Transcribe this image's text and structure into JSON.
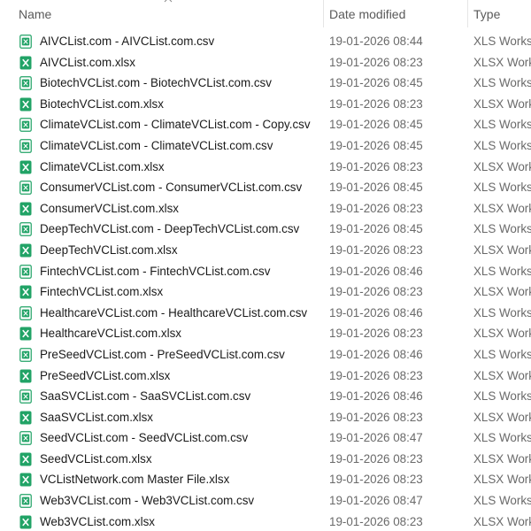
{
  "header": {
    "name_label": "Name",
    "date_label": "Date modified",
    "type_label": "Type",
    "sort_icon": "chevron-up-icon"
  },
  "files": [
    {
      "name": "AIVCList.com - AIVCList.com.csv",
      "date": "19-01-2026 08:44",
      "type": "XLS Works",
      "icon": "csv"
    },
    {
      "name": "AIVCList.com.xlsx",
      "date": "19-01-2026 08:23",
      "type": "XLSX Work",
      "icon": "xlsx"
    },
    {
      "name": "BiotechVCList.com - BiotechVCList.com.csv",
      "date": "19-01-2026 08:45",
      "type": "XLS Works",
      "icon": "csv"
    },
    {
      "name": "BiotechVCList.com.xlsx",
      "date": "19-01-2026 08:23",
      "type": "XLSX Work",
      "icon": "xlsx"
    },
    {
      "name": "ClimateVCList.com - ClimateVCList.com - Copy.csv",
      "date": "19-01-2026 08:45",
      "type": "XLS Works",
      "icon": "csv"
    },
    {
      "name": "ClimateVCList.com - ClimateVCList.com.csv",
      "date": "19-01-2026 08:45",
      "type": "XLS Works",
      "icon": "csv"
    },
    {
      "name": "ClimateVCList.com.xlsx",
      "date": "19-01-2026 08:23",
      "type": "XLSX Work",
      "icon": "xlsx"
    },
    {
      "name": "ConsumerVCList.com - ConsumerVCList.com.csv",
      "date": "19-01-2026 08:45",
      "type": "XLS Works",
      "icon": "csv"
    },
    {
      "name": "ConsumerVCList.com.xlsx",
      "date": "19-01-2026 08:23",
      "type": "XLSX Work",
      "icon": "xlsx"
    },
    {
      "name": "DeepTechVCList.com - DeepTechVCList.com.csv",
      "date": "19-01-2026 08:45",
      "type": "XLS Works",
      "icon": "csv"
    },
    {
      "name": "DeepTechVCList.com.xlsx",
      "date": "19-01-2026 08:23",
      "type": "XLSX Work",
      "icon": "xlsx"
    },
    {
      "name": "FintechVCList.com - FintechVCList.com.csv",
      "date": "19-01-2026 08:46",
      "type": "XLS Works",
      "icon": "csv"
    },
    {
      "name": "FintechVCList.com.xlsx",
      "date": "19-01-2026 08:23",
      "type": "XLSX Work",
      "icon": "xlsx"
    },
    {
      "name": "HealthcareVCList.com - HealthcareVCList.com.csv",
      "date": "19-01-2026 08:46",
      "type": "XLS Works",
      "icon": "csv"
    },
    {
      "name": "HealthcareVCList.com.xlsx",
      "date": "19-01-2026 08:23",
      "type": "XLSX Work",
      "icon": "xlsx"
    },
    {
      "name": "PreSeedVCList.com - PreSeedVCList.com.csv",
      "date": "19-01-2026 08:46",
      "type": "XLS Works",
      "icon": "csv"
    },
    {
      "name": "PreSeedVCList.com.xlsx",
      "date": "19-01-2026 08:23",
      "type": "XLSX Work",
      "icon": "xlsx"
    },
    {
      "name": "SaaSVCList.com - SaaSVCList.com.csv",
      "date": "19-01-2026 08:46",
      "type": "XLS Works",
      "icon": "csv"
    },
    {
      "name": "SaaSVCList.com.xlsx",
      "date": "19-01-2026 08:23",
      "type": "XLSX Work",
      "icon": "xlsx"
    },
    {
      "name": "SeedVCList.com - SeedVCList.com.csv",
      "date": "19-01-2026 08:47",
      "type": "XLS Works",
      "icon": "csv"
    },
    {
      "name": "SeedVCList.com.xlsx",
      "date": "19-01-2026 08:23",
      "type": "XLSX Work",
      "icon": "xlsx"
    },
    {
      "name": "VCListNetwork.com Master File.xlsx",
      "date": "19-01-2026 08:23",
      "type": "XLSX Work",
      "icon": "xlsx"
    },
    {
      "name": "Web3VCList.com - Web3VCList.com.csv",
      "date": "19-01-2026 08:47",
      "type": "XLS Works",
      "icon": "csv"
    },
    {
      "name": "Web3VCList.com.xlsx",
      "date": "19-01-2026 08:23",
      "type": "XLSX Work",
      "icon": "xlsx"
    }
  ],
  "colors": {
    "xlsx_icon": "#21a366",
    "csv_icon_border": "#21a366",
    "header_text": "#5a5a5a",
    "meta_text": "#6a6a6a"
  }
}
